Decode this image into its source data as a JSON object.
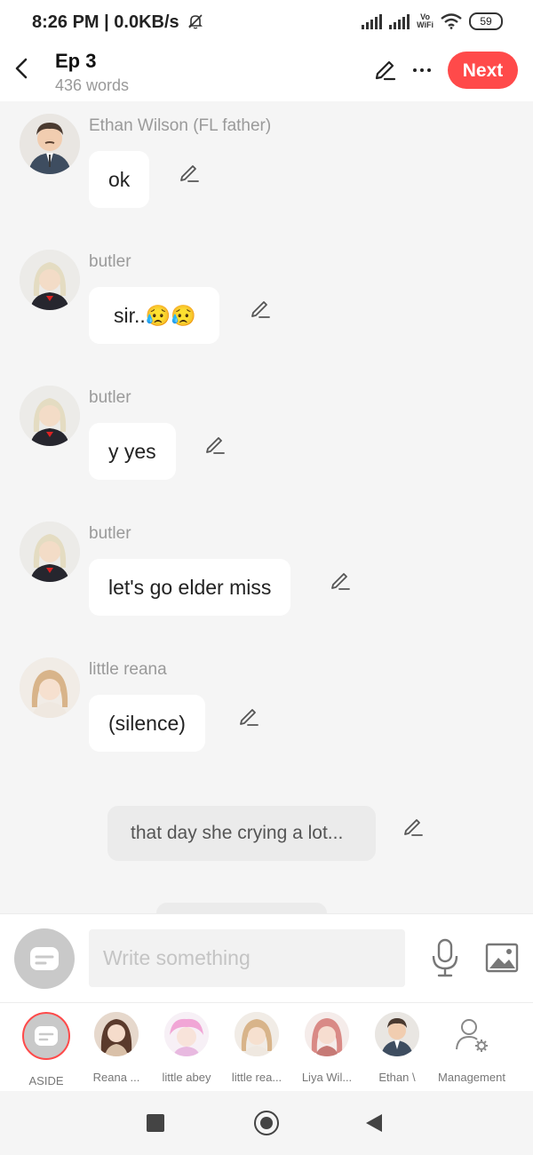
{
  "status_bar": {
    "time_and_speed": "8:26 PM | 0.0KB/s",
    "vowifi_top": "Vo",
    "vowifi_bottom": "WiFi",
    "battery": "59"
  },
  "header": {
    "title": "Ep 3",
    "word_count": "436 words",
    "next_label": "Next",
    "accent_color": "#ff4a4a"
  },
  "messages": [
    {
      "speaker": "Ethan Wilson (FL father)",
      "text": "ok",
      "avatar": "ethan-wilson-avatar"
    },
    {
      "speaker": "butler",
      "text": "sir..😥😥",
      "avatar": "butler-avatar"
    },
    {
      "speaker": "butler",
      "text": "y yes",
      "avatar": "butler-avatar"
    },
    {
      "speaker": "butler",
      "text": "let's go elder miss",
      "avatar": "butler-avatar"
    },
    {
      "speaker": "little reana",
      "text": "(silence)",
      "avatar": "little-reana-avatar"
    }
  ],
  "aside_message": {
    "text": "that day she crying a lot..."
  },
  "input": {
    "placeholder": "Write something"
  },
  "characters": [
    {
      "label": "ASIDE"
    },
    {
      "label": "Reana ..."
    },
    {
      "label": "little abey"
    },
    {
      "label": "little rea..."
    },
    {
      "label": "Liya Wil..."
    },
    {
      "label": "Ethan \\"
    },
    {
      "label": "Management"
    }
  ]
}
